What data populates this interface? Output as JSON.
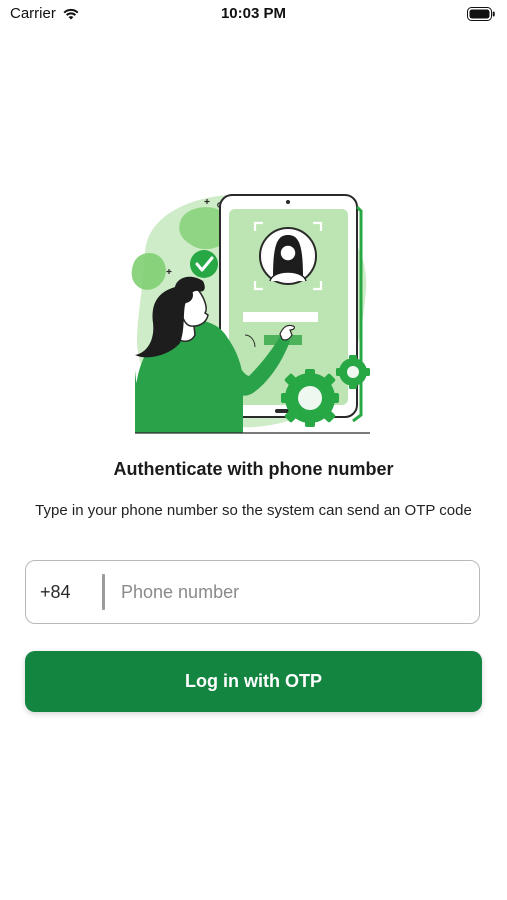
{
  "status_bar": {
    "carrier": "Carrier",
    "time": "10:03 PM"
  },
  "illustration": {
    "icon": "phone-authentication-illustration"
  },
  "content": {
    "title": "Authenticate with phone number",
    "subtitle": "Type in your phone number so the system can send an OTP code"
  },
  "phone_field": {
    "country_code": "+84",
    "value": "",
    "placeholder": "Phone number"
  },
  "actions": {
    "login_label": "Log in with OTP"
  },
  "colors": {
    "primary": "#138540",
    "illustration_light": "#a7dc9a",
    "illustration_accent": "#28a745"
  }
}
